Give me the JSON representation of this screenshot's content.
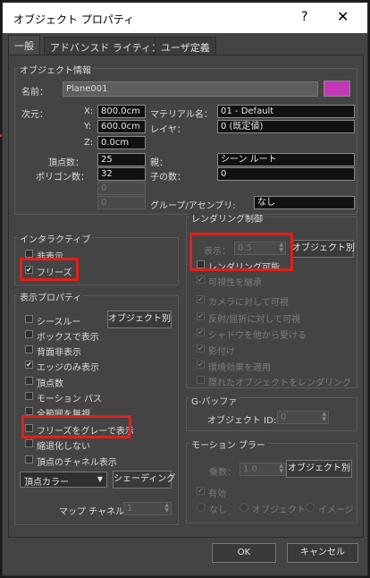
{
  "window": {
    "title": "オブジェクト プロパティ",
    "help_glyph": "?",
    "close_glyph": "✕"
  },
  "tabs": [
    "一般",
    "アドバンスド ライティング",
    "ユーザ定義"
  ],
  "object_info": {
    "group_title": "オブジェクト情報",
    "name_label": "名前：",
    "name_value": "Plane001",
    "color_swatch": "#c338b8",
    "dimensions_label": "次元：",
    "x_label": "X:",
    "x_value": "800.0cm",
    "y_label": "Y:",
    "y_value": "600.0cm",
    "z_label": "Z:",
    "z_value": "0.0cm",
    "material_label": "マテリアル名：",
    "material_value": "01 - Default",
    "layer_label": "レイヤ：",
    "layer_value": "0 (既定値)",
    "vertices_label": "頂点数：",
    "vertices_value": "25",
    "polygons_label": "ポリゴン数：",
    "polygons_value": "32",
    "parent_label": "親：",
    "parent_value": "シーン ルート",
    "children_label": "子の数：",
    "children_value": "0",
    "extra1_value": "0",
    "extra2_value": "0",
    "group_assembly_label": "グループ/アセンブリ:",
    "group_assembly_value": "なし"
  },
  "interactive": {
    "group_title": "インタラクティブ",
    "hide": "非表示",
    "freeze": "フリーズ"
  },
  "display_props": {
    "group_title": "表示プロパティ",
    "see_through": "シースルー",
    "by_object_button": "オブジェクト別",
    "display_as_box": "ボックスで表示",
    "backface_cull": "背面非表示",
    "edges_only": "エッジのみ表示",
    "vertex_ticks": "頂点数",
    "motion_path": "モーション パス",
    "ignore_extents": "全範囲を無視",
    "show_frozen_gray": "フリーズをグレーで表示",
    "never_degrade": "縮退化しない",
    "vertex_channel_display": "頂点のチャネル表示",
    "vertex_color_dropdown": "頂点カラー",
    "shaded_button": "シェーディング",
    "map_channel_label": "マップ チャネル：",
    "map_channel_value": "1"
  },
  "rendering_control": {
    "group_title": "レンダリング制御",
    "visibility_label": "表示：",
    "visibility_value": "0.5",
    "by_object_button": "オブジェクト別",
    "renderable": "レンダリング可能",
    "inherit_visibility": "可視性を継承",
    "visible_to_camera": "カメラに対して可視",
    "visible_reflect_refract": "反射/屈折に対して可視",
    "receive_shadows": "シャドウを他から受ける",
    "cast_shadows": "影付け",
    "apply_atmospherics": "環境効果を適用",
    "render_occluded": "隠れたオブジェクトをレンダリング"
  },
  "gbuffer": {
    "group_title": "G-バッファ",
    "object_id_label": "オブジェクト ID:",
    "object_id_value": "0"
  },
  "motion_blur": {
    "group_title": "モーション ブラー",
    "multiplier_label": "乗数：",
    "multiplier_value": "1.0",
    "by_object_button": "オブジェクト別",
    "enabled": "有効",
    "none": "なし",
    "object": "オブジェクト",
    "image": "イメージ"
  },
  "footer": {
    "ok": "OK",
    "cancel": "キャンセル"
  },
  "checked_glyph": "✔",
  "annotation_color": "#e0201b"
}
